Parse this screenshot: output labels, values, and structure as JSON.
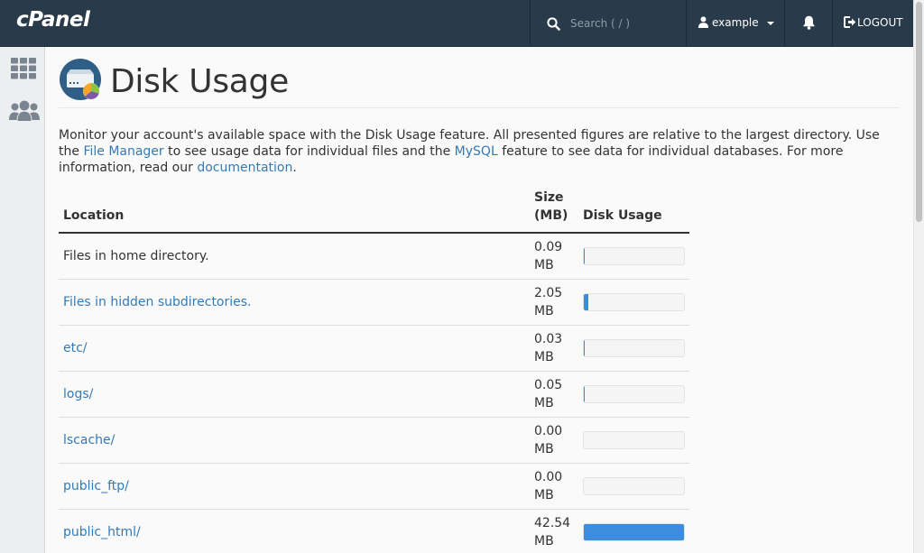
{
  "app": {
    "logo": "cPanel"
  },
  "topbar": {
    "search_placeholder": "Search ( / )",
    "username": "example",
    "logout_label": "LOGOUT"
  },
  "colors": {
    "topbar": "#293a4a",
    "link": "#337ab7",
    "bar_fill": "#3c8dde",
    "sidebar": "#eceeef"
  },
  "sidebar": {
    "items": [
      {
        "icon": "grid-icon"
      },
      {
        "icon": "users-icon"
      }
    ]
  },
  "page": {
    "title": "Disk Usage",
    "description": {
      "t1": "Monitor your account's available space with the Disk Usage feature. All presented figures are relative to the largest directory. Use the ",
      "link1": "File Manager",
      "t2": " to see usage data for individual files and the ",
      "link2": "MySQL",
      "t3": " feature to see data for individual databases. For more information, read our ",
      "link3": "documentation",
      "t4": "."
    }
  },
  "table": {
    "headers": {
      "location": "Location",
      "size": "Size (MB)",
      "usage": "Disk Usage"
    },
    "rows": [
      {
        "location": "Files in home directory.",
        "is_link": false,
        "size": "0.09 MB",
        "usage_fraction": 0.002
      },
      {
        "location": "Files in hidden subdirectories.",
        "is_link": true,
        "size": "2.05 MB",
        "usage_fraction": 0.048
      },
      {
        "location": "etc/",
        "is_link": true,
        "size": "0.03 MB",
        "usage_fraction": 0.001
      },
      {
        "location": "logs/",
        "is_link": true,
        "size": "0.05 MB",
        "usage_fraction": 0.001
      },
      {
        "location": "lscache/",
        "is_link": true,
        "size": "0.00 MB",
        "usage_fraction": 0
      },
      {
        "location": "public_ftp/",
        "is_link": true,
        "size": "0.00 MB",
        "usage_fraction": 0
      },
      {
        "location": "public_html/",
        "is_link": true,
        "size": "42.54 MB",
        "usage_fraction": 1.0
      }
    ]
  }
}
